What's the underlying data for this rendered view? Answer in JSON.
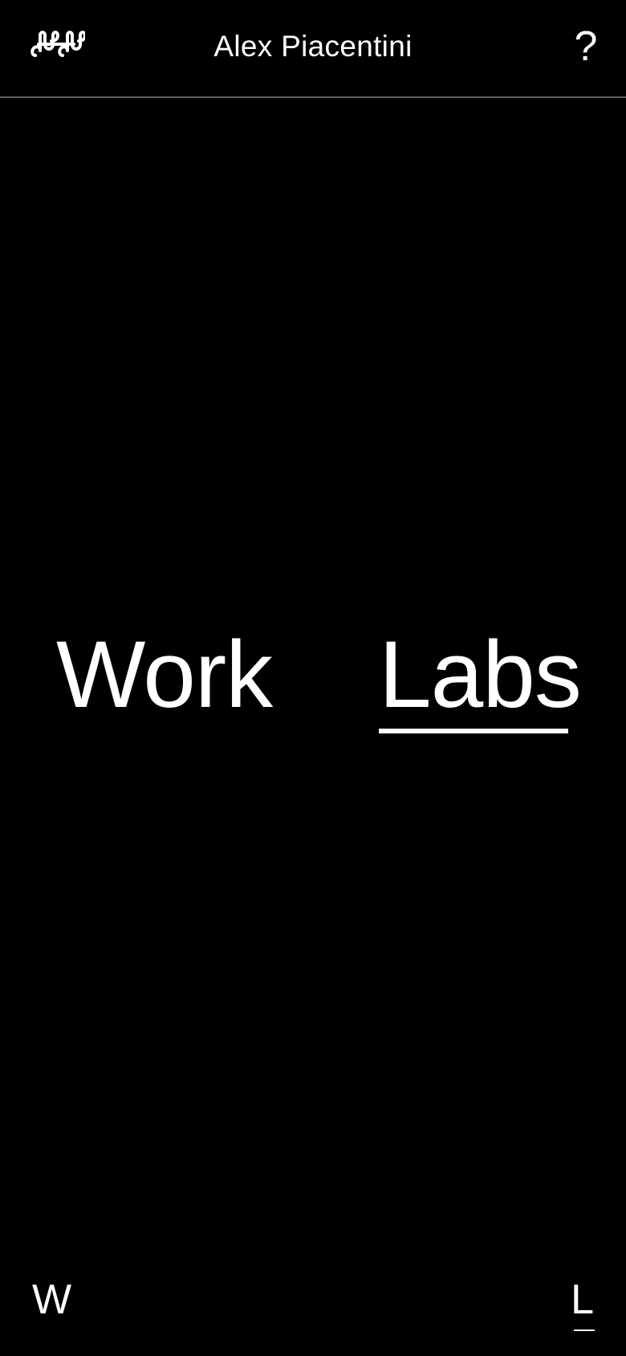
{
  "header": {
    "title": "Alex Piacentini",
    "logo_icon": "ap-monogram-icon",
    "help_label": "?"
  },
  "main": {
    "nav": [
      {
        "label": "Work",
        "active": false
      },
      {
        "label": "Labs",
        "active": true
      }
    ]
  },
  "footer": {
    "left_label": "W",
    "right_label": "L",
    "active": "L"
  },
  "colors": {
    "background": "#000000",
    "foreground": "#ffffff",
    "divider": "#5f5f5f"
  }
}
